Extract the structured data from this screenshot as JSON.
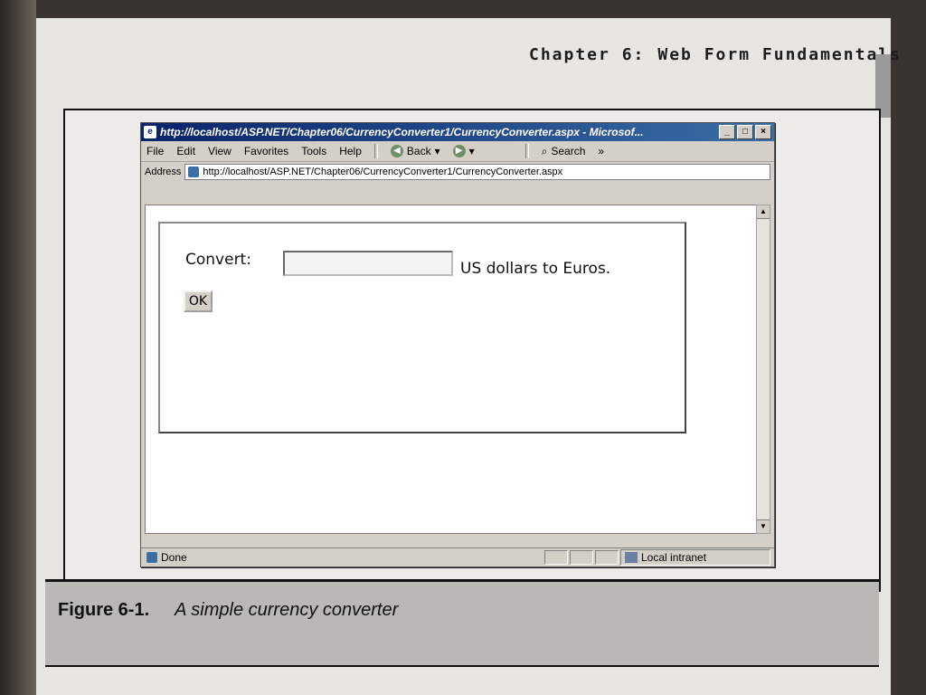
{
  "book": {
    "chapter": "Chapter 6:",
    "section": "Web Form Fundamentals",
    "figure_label": "Figure 6-1.",
    "figure_caption": "A simple currency converter"
  },
  "browser": {
    "title": "http://localhost/ASP.NET/Chapter06/CurrencyConverter1/CurrencyConverter.aspx - Microsof...",
    "menu": [
      "File",
      "Edit",
      "View",
      "Favorites",
      "Tools",
      "Help"
    ],
    "toolbar": {
      "back_label": "Back",
      "search_label": "Search",
      "more": "»"
    },
    "address_label": "Address",
    "address_value": "http://localhost/ASP.NET/Chapter06/CurrencyConverter1/CurrencyConverter.aspx",
    "status_text": "Done",
    "zone_text": "Local intranet"
  },
  "form": {
    "convert_label": "Convert:",
    "amount_value": "",
    "unit_text": "US dollars to Euros.",
    "ok_label": "OK"
  }
}
